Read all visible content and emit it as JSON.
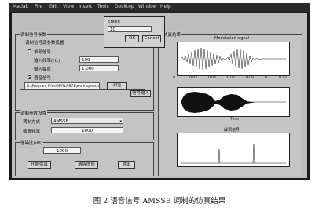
{
  "menubar": {
    "items": [
      "Matlab",
      "File",
      "Edit",
      "View",
      "Insert",
      "Tools",
      "Desktop",
      "Window",
      "Help"
    ]
  },
  "params_panel": {
    "title": "调制信号参数",
    "sub_title": "调制信号源参数设置",
    "radio_single": "单频信号",
    "freq_label": "输入频率(Hz)",
    "freq_value": "100",
    "amp_label": "输入幅度",
    "amp_value": "1.000",
    "radio_speech": "语音信号",
    "file_path": "D:\\Program Files\\MATLAB71\\work\\speech.wav",
    "browse_button": "浏览",
    "input_button": "信号输入"
  },
  "mod_panel": {
    "title": "调制参数设置",
    "mode_label": "调制方式",
    "mode_value": "AMSSB",
    "carrier_label": "载波频率",
    "carrier_value": "1000"
  },
  "snr_panel": {
    "title": "信噪比(dB)",
    "snr_value": "1000",
    "buttons": [
      "开始仿真",
      "清除图形",
      "退出"
    ]
  },
  "plot_panel": {
    "title": "仿真结果",
    "plot1_title": "Modulation signal",
    "plot1_xticks": [
      "0",
      "0.02",
      "0.04",
      "0.06",
      "0.08",
      "0.1",
      "0.12"
    ],
    "plot2_xlabel": "Time",
    "plot3_title": "解调信号"
  },
  "dialog": {
    "label": "Enter:",
    "value": "10",
    "ok": "OK",
    "cancel": "Cancel"
  },
  "caption": "图 2  语音信号 AMSSB 调制的仿真结果"
}
